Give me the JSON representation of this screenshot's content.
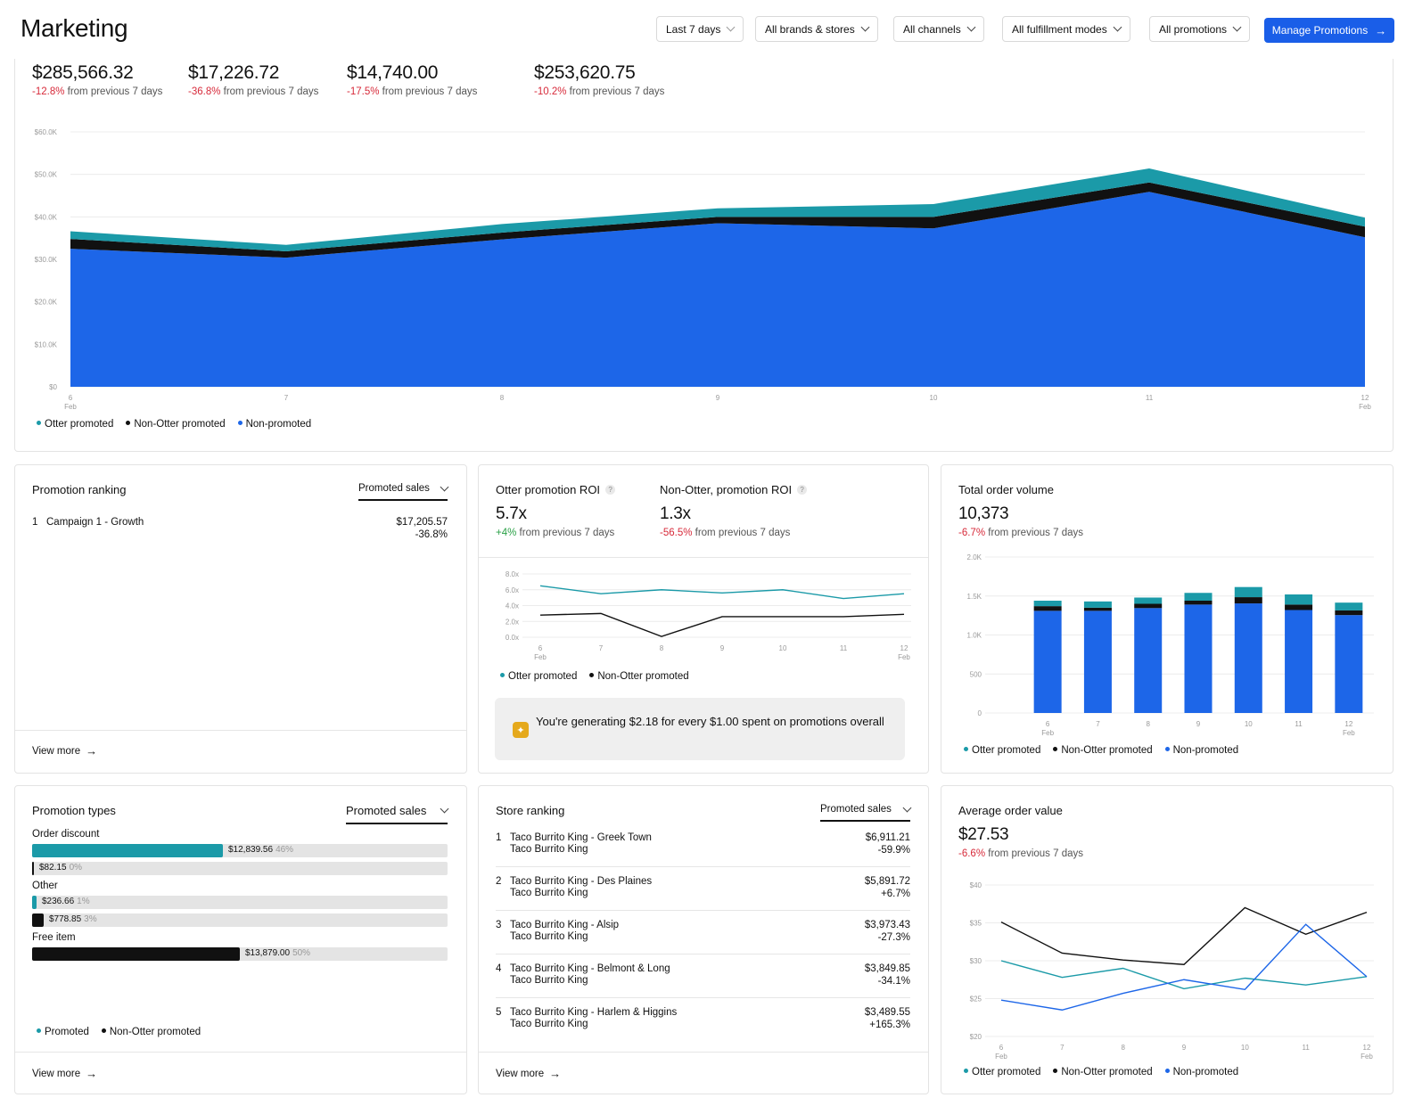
{
  "header": {
    "title": "Marketing",
    "filters": [
      "Last 7 days",
      "All brands & stores",
      "All channels",
      "All fulfillment modes",
      "All promotions"
    ],
    "manage_button": "Manage Promotions"
  },
  "colors": {
    "otter": "#1b9aa8",
    "non_otter": "#111111",
    "non_promoted": "#1d66e8",
    "accent": "#1a5ee8",
    "negative": "#d72a3a",
    "positive": "#2aa147"
  },
  "icons": {
    "arrow": "arrow-right-icon",
    "chevron": "chevron-down-icon",
    "sparkle": "sparkle-icon",
    "help": "help-icon"
  },
  "summary": {
    "kpis": [
      {
        "value": "$285,566.32",
        "change": "-12.8%",
        "suffix": "from previous 7 days"
      },
      {
        "value": "$17,226.72",
        "change": "-36.8%",
        "suffix": "from previous 7 days"
      },
      {
        "value": "$14,740.00",
        "change": "-17.5%",
        "suffix": "from previous 7 days"
      },
      {
        "value": "$253,620.75",
        "change": "-10.2%",
        "suffix": "from previous 7 days"
      }
    ],
    "legend": [
      "Otter promoted",
      "Non-Otter promoted",
      "Non-promoted"
    ]
  },
  "promotion_ranking": {
    "title": "Promotion ranking",
    "sort": "Promoted sales",
    "items": [
      {
        "rank": "1",
        "name": "Campaign 1 - Growth",
        "value": "$17,205.57",
        "change": "-36.8%"
      }
    ],
    "view_more": "View more"
  },
  "roi": {
    "otter_title": "Otter promotion ROI",
    "otter_value": "5.7x",
    "otter_change": "+4%",
    "non_otter_title": "Non-Otter, promotion ROI",
    "non_otter_value": "1.3x",
    "non_otter_change": "-56.5%",
    "suffix": "from previous 7 days",
    "help_glyph": "?",
    "legend": [
      "Otter promoted",
      "Non-Otter promoted"
    ],
    "insight": "You're generating $2.18 for every $1.00 spent on promotions overall"
  },
  "order_volume": {
    "title": "Total order volume",
    "value": "10,373",
    "change": "-6.7%",
    "suffix": "from previous 7 days",
    "legend": [
      "Otter promoted",
      "Non-Otter promoted",
      "Non-promoted"
    ]
  },
  "promotion_types": {
    "title": "Promotion types",
    "sort": "Promoted sales",
    "groups": [
      {
        "label": "Order discount",
        "bars": [
          {
            "value": "$12,839.56",
            "pct": "46%",
            "fraction": 0.46,
            "kind": "otter"
          },
          {
            "value": "$82.15",
            "pct": "0%",
            "fraction": 0.003,
            "kind": "non_otter"
          }
        ]
      },
      {
        "label": "Other",
        "bars": [
          {
            "value": "$236.66",
            "pct": "1%",
            "fraction": 0.01,
            "kind": "otter"
          },
          {
            "value": "$778.85",
            "pct": "3%",
            "fraction": 0.028,
            "kind": "non_otter"
          }
        ]
      },
      {
        "label": "Free item",
        "bars": [
          {
            "value": "$13,879.00",
            "pct": "50%",
            "fraction": 0.5,
            "kind": "non_otter"
          }
        ]
      }
    ],
    "legend": [
      "Promoted",
      "Non-Otter promoted"
    ],
    "view_more": "View more"
  },
  "store_ranking": {
    "title": "Store ranking",
    "sort": "Promoted sales",
    "items": [
      {
        "rank": "1",
        "name": "Taco Burrito King - Greek Town",
        "brand": "Taco Burrito King",
        "value": "$6,911.21",
        "change": "-59.9%",
        "dir": "neg"
      },
      {
        "rank": "2",
        "name": "Taco Burrito King - Des Plaines",
        "brand": "Taco Burrito King",
        "value": "$5,891.72",
        "change": "+6.7%",
        "dir": "pos"
      },
      {
        "rank": "3",
        "name": "Taco Burrito King - Alsip",
        "brand": "Taco Burrito King",
        "value": "$3,973.43",
        "change": "-27.3%",
        "dir": "neg"
      },
      {
        "rank": "4",
        "name": "Taco Burrito King - Belmont & Long",
        "brand": "Taco Burrito King",
        "value": "$3,849.85",
        "change": "-34.1%",
        "dir": "neg"
      },
      {
        "rank": "5",
        "name": "Taco Burrito King - Harlem & Higgins",
        "brand": "Taco Burrito King",
        "value": "$3,489.55",
        "change": "+165.3%",
        "dir": "pos"
      }
    ],
    "view_more": "View more"
  },
  "aov": {
    "title": "Average order value",
    "value": "$27.53",
    "change": "-6.6%",
    "suffix": "from previous 7 days",
    "legend": [
      "Otter promoted",
      "Non-Otter promoted",
      "Non-promoted"
    ]
  },
  "chart_data": [
    {
      "type": "area",
      "stacked": true,
      "x": [
        "6",
        "7",
        "8",
        "9",
        "10",
        "11",
        "12"
      ],
      "x_month_labels": [
        "Feb",
        "",
        "",
        "",
        "",
        "",
        "Feb"
      ],
      "yticks": [
        "$0",
        "$10.0K",
        "$20.0K",
        "$30.0K",
        "$40.0K",
        "$50.0K",
        "$60.0K"
      ],
      "ylim": [
        0,
        60000
      ],
      "grid": true,
      "legend_position": "bottom-left",
      "series": [
        {
          "name": "Non-promoted",
          "color": "#1d66e8",
          "values": [
            32500,
            30400,
            34700,
            38500,
            37300,
            45900,
            35200
          ]
        },
        {
          "name": "Non-Otter promoted",
          "color": "#111111",
          "values": [
            2300,
            1500,
            1600,
            1500,
            2700,
            2200,
            2500
          ]
        },
        {
          "name": "Otter promoted",
          "color": "#1b9aa8",
          "values": [
            1800,
            1500,
            2000,
            2000,
            3000,
            3300,
            2100
          ]
        }
      ]
    },
    {
      "type": "line",
      "x": [
        "6",
        "7",
        "8",
        "9",
        "10",
        "11",
        "12"
      ],
      "x_month_labels": [
        "Feb",
        "",
        "",
        "",
        "",
        "",
        "Feb"
      ],
      "yticks": [
        "0.0x",
        "2.0x",
        "4.0x",
        "6.0x",
        "8.0x"
      ],
      "ylim": [
        0,
        8
      ],
      "grid": true,
      "legend_position": "bottom-left",
      "series": [
        {
          "name": "Otter promoted",
          "color": "#1b9aa8",
          "values": [
            6.5,
            5.5,
            6.0,
            5.6,
            6.0,
            4.9,
            5.5
          ]
        },
        {
          "name": "Non-Otter promoted",
          "color": "#111111",
          "values": [
            2.8,
            3.0,
            0.1,
            2.6,
            2.6,
            2.6,
            2.9
          ]
        }
      ]
    },
    {
      "type": "bar",
      "stacked": true,
      "categories": [
        "6",
        "7",
        "8",
        "9",
        "10",
        "11",
        "12"
      ],
      "x_month_labels": [
        "Feb",
        "",
        "",
        "",
        "",
        "",
        "Feb"
      ],
      "yticks": [
        "0",
        "500",
        "1.0K",
        "1.5K",
        "2.0K"
      ],
      "ylim": [
        0,
        2000
      ],
      "grid": true,
      "legend_position": "bottom-left",
      "series": [
        {
          "name": "Non-promoted",
          "color": "#1d66e8",
          "values": [
            1310,
            1310,
            1345,
            1390,
            1405,
            1320,
            1255
          ]
        },
        {
          "name": "Non-Otter promoted",
          "color": "#111111",
          "values": [
            60,
            40,
            55,
            50,
            80,
            70,
            60
          ]
        },
        {
          "name": "Otter promoted",
          "color": "#1b9aa8",
          "values": [
            70,
            80,
            80,
            100,
            130,
            130,
            100
          ]
        }
      ]
    },
    {
      "type": "line",
      "x": [
        "6",
        "7",
        "8",
        "9",
        "10",
        "11",
        "12"
      ],
      "x_month_labels": [
        "Feb",
        "",
        "",
        "",
        "",
        "",
        "Feb"
      ],
      "yticks": [
        "$20",
        "$25",
        "$30",
        "$35",
        "$40"
      ],
      "ylim": [
        20,
        40
      ],
      "grid": true,
      "legend_position": "bottom-left",
      "series": [
        {
          "name": "Otter promoted",
          "color": "#1b9aa8",
          "values": [
            30.0,
            27.8,
            29.0,
            26.3,
            27.7,
            26.8,
            27.9
          ]
        },
        {
          "name": "Non-Otter promoted",
          "color": "#111111",
          "values": [
            35.1,
            31.0,
            30.1,
            29.5,
            37.0,
            33.5,
            36.4
          ]
        },
        {
          "name": "Non-promoted",
          "color": "#1d66e8",
          "values": [
            24.8,
            23.5,
            25.7,
            27.5,
            26.2,
            34.8,
            27.9
          ]
        }
      ]
    }
  ]
}
